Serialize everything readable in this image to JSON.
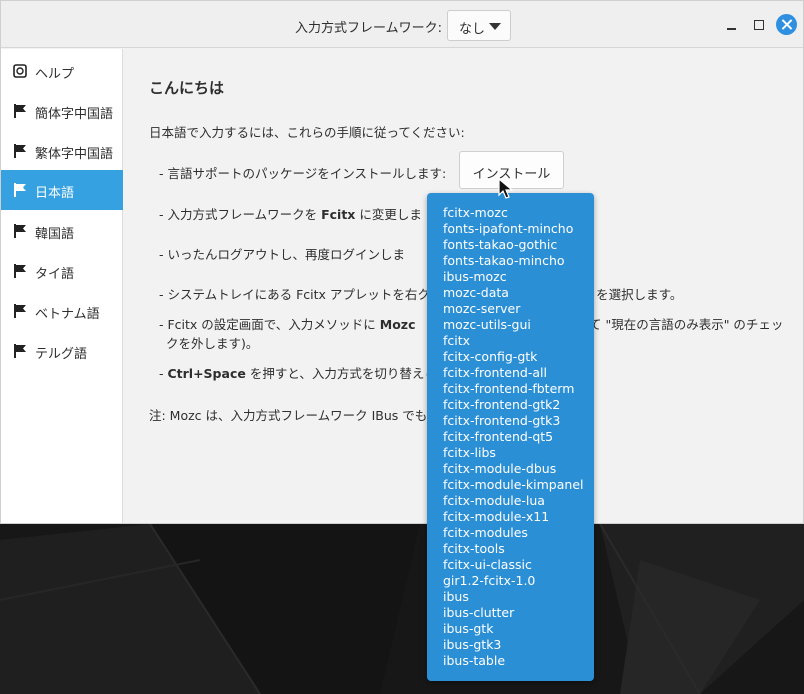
{
  "titlebar": {
    "framework_label": "入力方式フレームワーク:",
    "framework_value": "なし"
  },
  "sidebar": {
    "items": [
      {
        "label": "ヘルプ",
        "icon": "help-icon",
        "active": false
      },
      {
        "label": "簡体字中国語",
        "icon": "flag-icon",
        "active": false
      },
      {
        "label": "繁体字中国語",
        "icon": "flag-icon",
        "active": false
      },
      {
        "label": "日本語",
        "icon": "flag-icon",
        "active": true
      },
      {
        "label": "韓国語",
        "icon": "flag-icon",
        "active": false
      },
      {
        "label": "タイ語",
        "icon": "flag-icon",
        "active": false
      },
      {
        "label": "ベトナム語",
        "icon": "flag-icon",
        "active": false
      },
      {
        "label": "テルグ語",
        "icon": "flag-icon",
        "active": false
      }
    ]
  },
  "content": {
    "title": "こんにちは",
    "intro": "日本語で入力するには、これらの手順に従ってください:",
    "step1": "- 言語サポートのパッケージをインストールします:",
    "install_label": "インストール",
    "step2_pre": "- 入力方式フレームワークを ",
    "step2_bold": "Fcitx",
    "step2_post": " に変更しま",
    "step3": "- いったんログアウトし、再度ログインしま",
    "step4_pre": "- システムトレイにある Fcitx アプレットを右ク",
    "step4_post": "定\" を選択します。",
    "step5_pre": "- Fcitx の設定画面で、入力メソッドに ",
    "step5_bold": "Mozc",
    "step5_post": "に応じて \"現在の言語のみ表示\" のチェッ",
    "step5_line2": "クを外します)。",
    "step6_pre": "- ",
    "step6_bold": "Ctrl+Space",
    "step6_post": " を押すと、入力方式を切り替えら",
    "note": "注: Mozc は、入力方式フレームワーク IBus でも"
  },
  "packages": [
    "fcitx-mozc",
    "fonts-ipafont-mincho",
    "fonts-takao-gothic",
    "fonts-takao-mincho",
    "ibus-mozc",
    "mozc-data",
    "mozc-server",
    "mozc-utils-gui",
    "fcitx",
    "fcitx-config-gtk",
    "fcitx-frontend-all",
    "fcitx-frontend-fbterm",
    "fcitx-frontend-gtk2",
    "fcitx-frontend-gtk3",
    "fcitx-frontend-qt5",
    "fcitx-libs",
    "fcitx-module-dbus",
    "fcitx-module-kimpanel",
    "fcitx-module-lua",
    "fcitx-module-x11",
    "fcitx-modules",
    "fcitx-tools",
    "fcitx-ui-classic",
    "gir1.2-fcitx-1.0",
    "ibus",
    "ibus-clutter",
    "ibus-gtk",
    "ibus-gtk3",
    "ibus-table"
  ],
  "colors": {
    "accent": "#35a1e0",
    "dropdown_bg": "#2b8fd6",
    "close_button": "#2f8fe0"
  }
}
